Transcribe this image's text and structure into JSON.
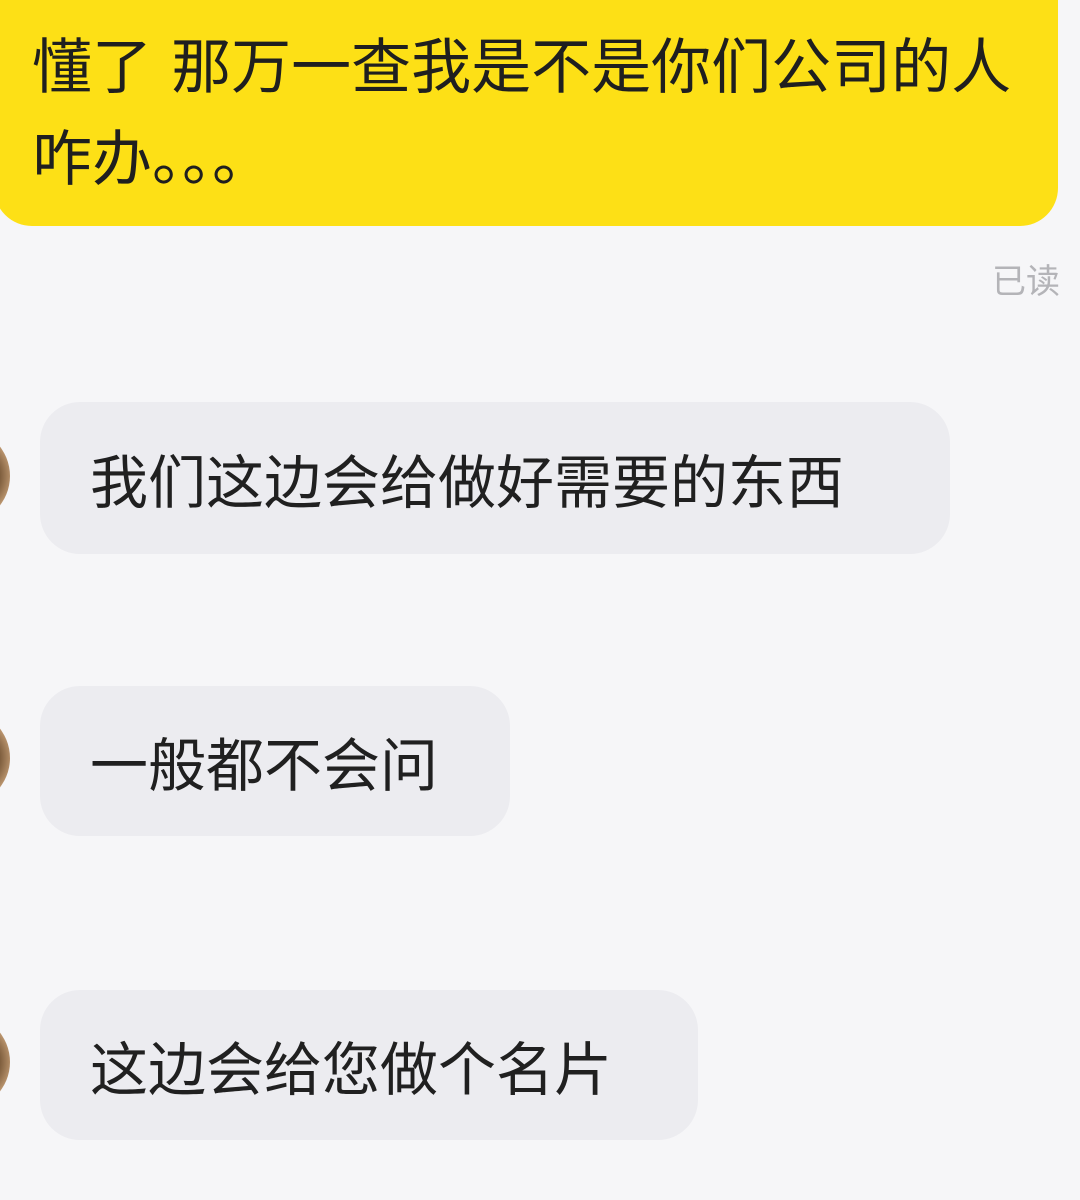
{
  "conversation": {
    "outgoing": {
      "text": "懂了 那万一查我是不是你们公司的人咋办。。。",
      "bubble_color": "#fde016"
    },
    "read_status": "已读",
    "incoming": [
      {
        "text": "我们这边会给做好需要的东西",
        "avatar_icon": "user-avatar-icon"
      },
      {
        "text": "一般都不会问",
        "avatar_icon": "user-avatar-icon"
      },
      {
        "text": "这边会给您做个名片",
        "avatar_icon": "user-avatar-icon"
      }
    ],
    "incoming_bubble_color": "#ececf0",
    "background_color": "#f6f6f8"
  }
}
